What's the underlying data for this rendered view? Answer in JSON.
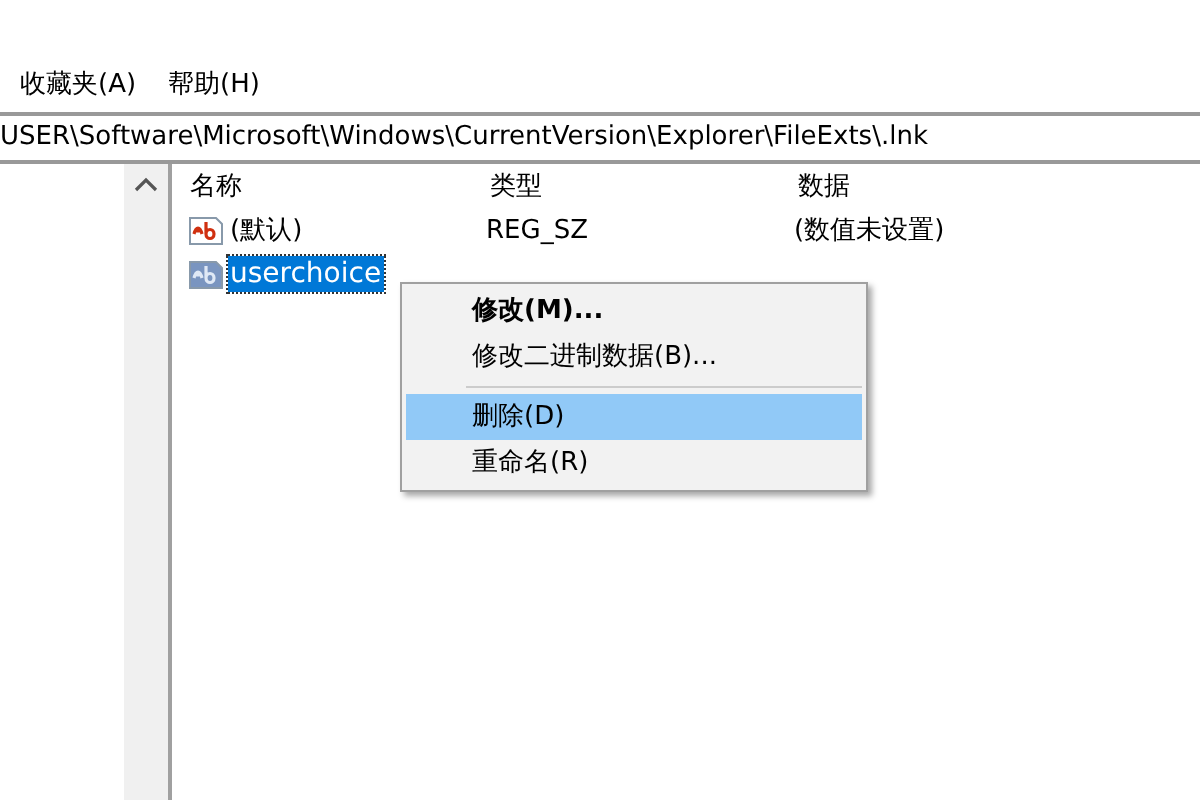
{
  "menu_bar": [
    {
      "label": "收藏夹(A)"
    },
    {
      "label": "帮助(H)"
    }
  ],
  "address": "USER\\Software\\Microsoft\\Windows\\CurrentVersion\\Explorer\\FileExts\\.lnk",
  "list": {
    "columns": [
      "名称",
      "类型",
      "数据"
    ],
    "rows": [
      {
        "name": "(默认)",
        "type": "REG_SZ",
        "data": "(数值未设置)",
        "selected": false
      },
      {
        "name": "userchoice",
        "selected": true
      }
    ]
  },
  "context_menu": [
    {
      "kind": "item",
      "label": "修改(M)...",
      "bold": true,
      "selected": false
    },
    {
      "kind": "item",
      "label": "修改二进制数据(B)...",
      "bold": false,
      "selected": false
    },
    {
      "kind": "separator"
    },
    {
      "kind": "item",
      "label": "删除(D)",
      "bold": false,
      "selected": true
    },
    {
      "kind": "item",
      "label": "重命名(R)",
      "bold": false,
      "selected": false
    }
  ]
}
